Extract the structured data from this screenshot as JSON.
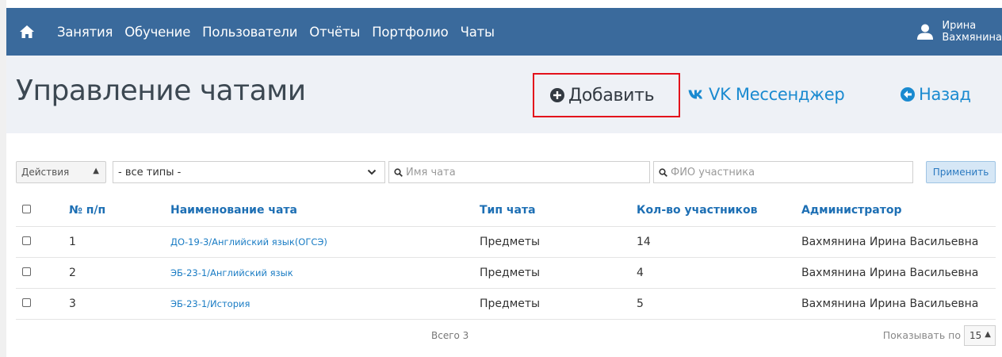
{
  "nav": {
    "items": [
      "Занятия",
      "Обучение",
      "Пользователи",
      "Отчёты",
      "Портфолио",
      "Чаты"
    ],
    "user_first": "Ирина",
    "user_last": "Вахмянина"
  },
  "header": {
    "title": "Управление чатами",
    "add_label": "Добавить",
    "vk_label": "VK Мессенджер",
    "back_label": "Назад"
  },
  "filters": {
    "actions_label": "Действия",
    "type_value": "- все типы -",
    "chat_name_placeholder": "Имя чата",
    "participant_placeholder": "ФИО участника",
    "apply_label": "Применить"
  },
  "table": {
    "columns": [
      "№ п/п",
      "Наименование чата",
      "Тип чата",
      "Кол-во участников",
      "Администратор"
    ],
    "rows": [
      {
        "num": "1",
        "name": "ДО-19-3/Английский язык(ОГСЭ)",
        "type": "Предметы",
        "count": "14",
        "admin": "Вахмянина Ирина Васильевна"
      },
      {
        "num": "2",
        "name": "ЭБ-23-1/Английский язык",
        "type": "Предметы",
        "count": "4",
        "admin": "Вахмянина Ирина Васильевна"
      },
      {
        "num": "3",
        "name": "ЭБ-23-1/История",
        "type": "Предметы",
        "count": "5",
        "admin": "Вахмянина Ирина Васильевна"
      }
    ]
  },
  "footer": {
    "total": "Всего 3",
    "per_page_label": "Показывать по",
    "per_page_value": "15"
  },
  "colors": {
    "navbar": "#3a6a9c",
    "link": "#1a8ad0",
    "highlight_border": "#e3111b"
  }
}
